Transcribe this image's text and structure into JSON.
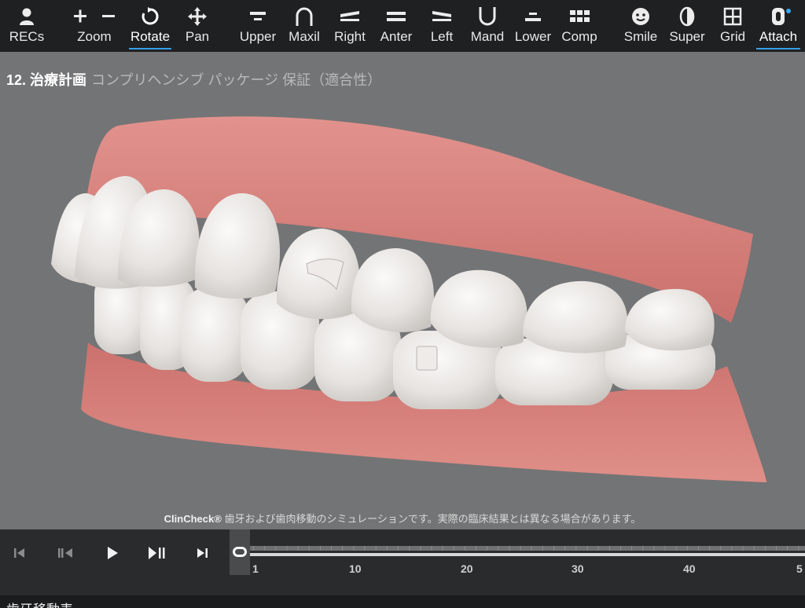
{
  "toolbar": {
    "items": [
      {
        "label": "RECs",
        "icon": "person-icon"
      },
      {
        "label": "+  −",
        "icon": "plus-minus-icon"
      },
      {
        "label": "Zoom",
        "icon": ""
      },
      {
        "label": "Rotate",
        "icon": "rotate-icon",
        "active": true
      },
      {
        "label": "Pan",
        "icon": "pan-arrows-icon"
      },
      {
        "label": "Upper",
        "icon": "upper-arch-icon"
      },
      {
        "label": "Maxil",
        "icon": "maxillary-arch-icon"
      },
      {
        "label": "Right",
        "icon": "right-view-icon"
      },
      {
        "label": "Anter",
        "icon": "anterior-view-icon"
      },
      {
        "label": "Left",
        "icon": "left-view-icon"
      },
      {
        "label": "Mand",
        "icon": "mandibular-arch-icon"
      },
      {
        "label": "Lower",
        "icon": "lower-arch-icon"
      },
      {
        "label": "Comp",
        "icon": "compare-grid-icon"
      },
      {
        "label": "Smile",
        "icon": "smile-face-icon"
      },
      {
        "label": "Super",
        "icon": "superimpose-icon"
      },
      {
        "label": "Grid",
        "icon": "grid-icon"
      },
      {
        "label": "Attach",
        "icon": "attachment-icon",
        "active": true
      }
    ]
  },
  "stage": {
    "title_number": "12. 治療計画",
    "title_sub": "コンプリヘンシブ パッケージ 保証（適合性）",
    "disclaimer_brand": "ClinCheck®",
    "disclaimer_text": " 歯牙および歯肉移動のシミュレーションです。実際の臨床結果とは異なる場合があります。"
  },
  "timeline": {
    "current_stage": 0,
    "tick_labels": [
      "1",
      "10",
      "20",
      "30",
      "40",
      "5"
    ]
  },
  "bottom_panel": {
    "title": "歯牙移動表"
  },
  "colors": {
    "accent": "#35a0e8",
    "gum": "#d77f7c",
    "tooth": "#e9e6e3"
  }
}
